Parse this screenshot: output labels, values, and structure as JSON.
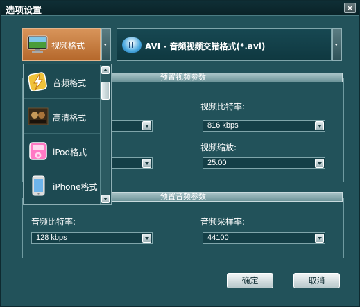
{
  "window": {
    "title": "选项设置",
    "close_glyph": "×"
  },
  "format_selector": {
    "current_label": "视频格式",
    "icon": "monitor-icon"
  },
  "profile": {
    "text": "AVI - 音频视频交错格式(*.avi)",
    "icon": "pause-pill-icon"
  },
  "format_list": {
    "items": [
      {
        "label": "音频格式",
        "icon": "lightning-audio-icon"
      },
      {
        "label": "高清格式",
        "icon": "movie-poster-icon"
      },
      {
        "label": "iPod格式",
        "icon": "ipod-icon"
      },
      {
        "label": "iPhone格式",
        "icon": "iphone-icon"
      }
    ]
  },
  "video_group": {
    "title": "预置视频参数",
    "bitrate_label": "视频比特率:",
    "bitrate_value": "816 kbps",
    "zoom_label": "视频缩放:",
    "zoom_value": "25.00"
  },
  "audio_group": {
    "title": "预置音频参数",
    "bitrate_label": "音频比特率:",
    "bitrate_value": "128 kbps",
    "samplerate_label": "音频采样率:",
    "samplerate_value": "44100"
  },
  "buttons": {
    "ok": "确定",
    "cancel": "取消"
  },
  "colors": {
    "background": "#22525a",
    "selected_format": "#c67a3c",
    "titlebar": "#0f2f36"
  }
}
